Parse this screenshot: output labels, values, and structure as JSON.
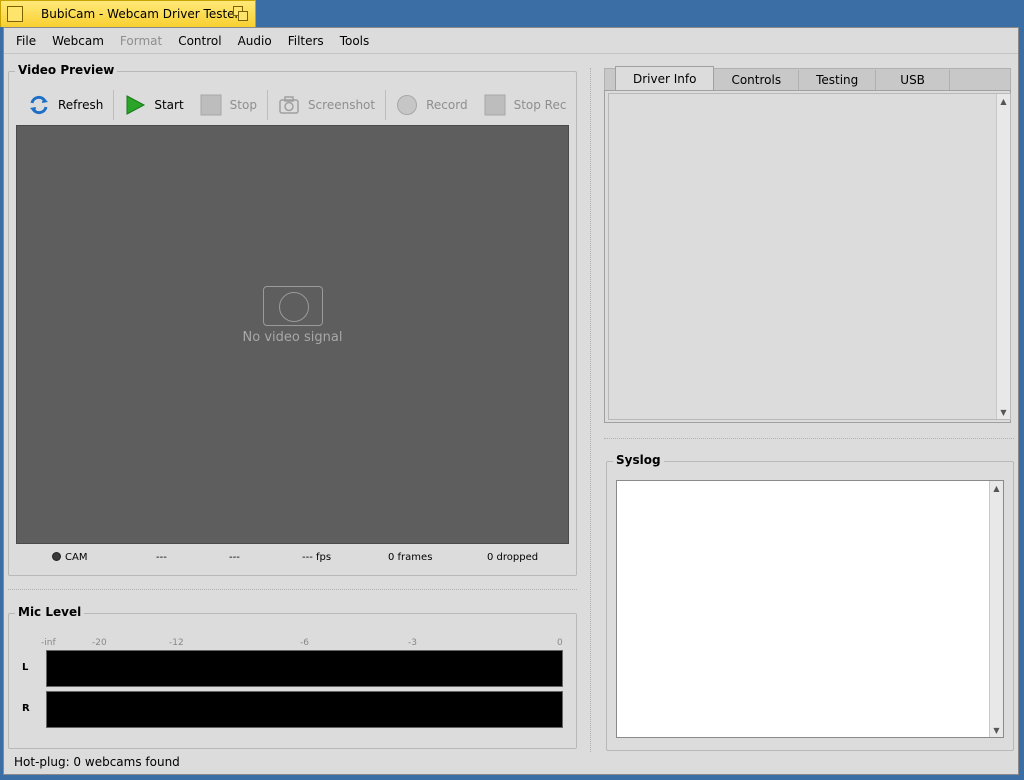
{
  "window": {
    "title": "BubiCam - Webcam Driver Tester"
  },
  "menu": [
    {
      "label": "File",
      "disabled": false
    },
    {
      "label": "Webcam",
      "disabled": false
    },
    {
      "label": "Format",
      "disabled": true
    },
    {
      "label": "Control",
      "disabled": false
    },
    {
      "label": "Audio",
      "disabled": false
    },
    {
      "label": "Filters",
      "disabled": false
    },
    {
      "label": "Tools",
      "disabled": false
    }
  ],
  "video_preview": {
    "title": "Video Preview",
    "toolbar": {
      "refresh": "Refresh",
      "start": "Start",
      "stop": "Stop",
      "screenshot": "Screenshot",
      "record": "Record",
      "stop_rec": "Stop Rec"
    },
    "no_signal": "No video signal",
    "status": {
      "cam": "CAM",
      "field1": "---",
      "field2": "---",
      "fps": "--- fps",
      "frames": "0 frames",
      "dropped": "0 dropped"
    }
  },
  "mic_level": {
    "title": "Mic Level",
    "scale": [
      "-inf",
      "-20",
      "-12",
      "-6",
      "-3",
      "0"
    ],
    "channels": [
      "L",
      "R"
    ]
  },
  "tabs": [
    "Driver Info",
    "Controls",
    "Testing",
    "USB"
  ],
  "syslog": {
    "title": "Syslog"
  },
  "statusbar": {
    "text": "Hot-plug: 0 webcams found"
  },
  "colors": {
    "title_tab": "#f8d030",
    "desktop": "#3a6ea5",
    "preview_bg": "#5e5e5e",
    "start_icon": "#2aa52a",
    "refresh_icon": "#1e6fc8"
  }
}
